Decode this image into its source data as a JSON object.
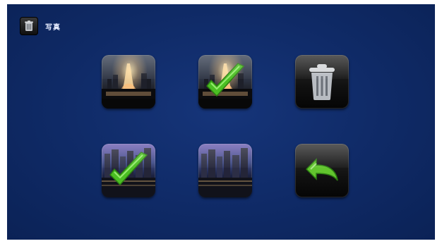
{
  "header": {
    "title": "写真",
    "icon": "trash-icon"
  },
  "grid": {
    "items": [
      {
        "name": "photo-fountain",
        "selected": false
      },
      {
        "name": "photo-fountain",
        "selected": true
      },
      {
        "name": "delete-action",
        "icon": "trash-can-icon"
      },
      {
        "name": "photo-city",
        "selected": true
      },
      {
        "name": "photo-city",
        "selected": false
      },
      {
        "name": "return-action",
        "icon": "back-arrow-icon"
      }
    ]
  },
  "colors": {
    "background": "#0f2a66",
    "check": "#5fcf2f",
    "arrow": "#62c52e"
  }
}
